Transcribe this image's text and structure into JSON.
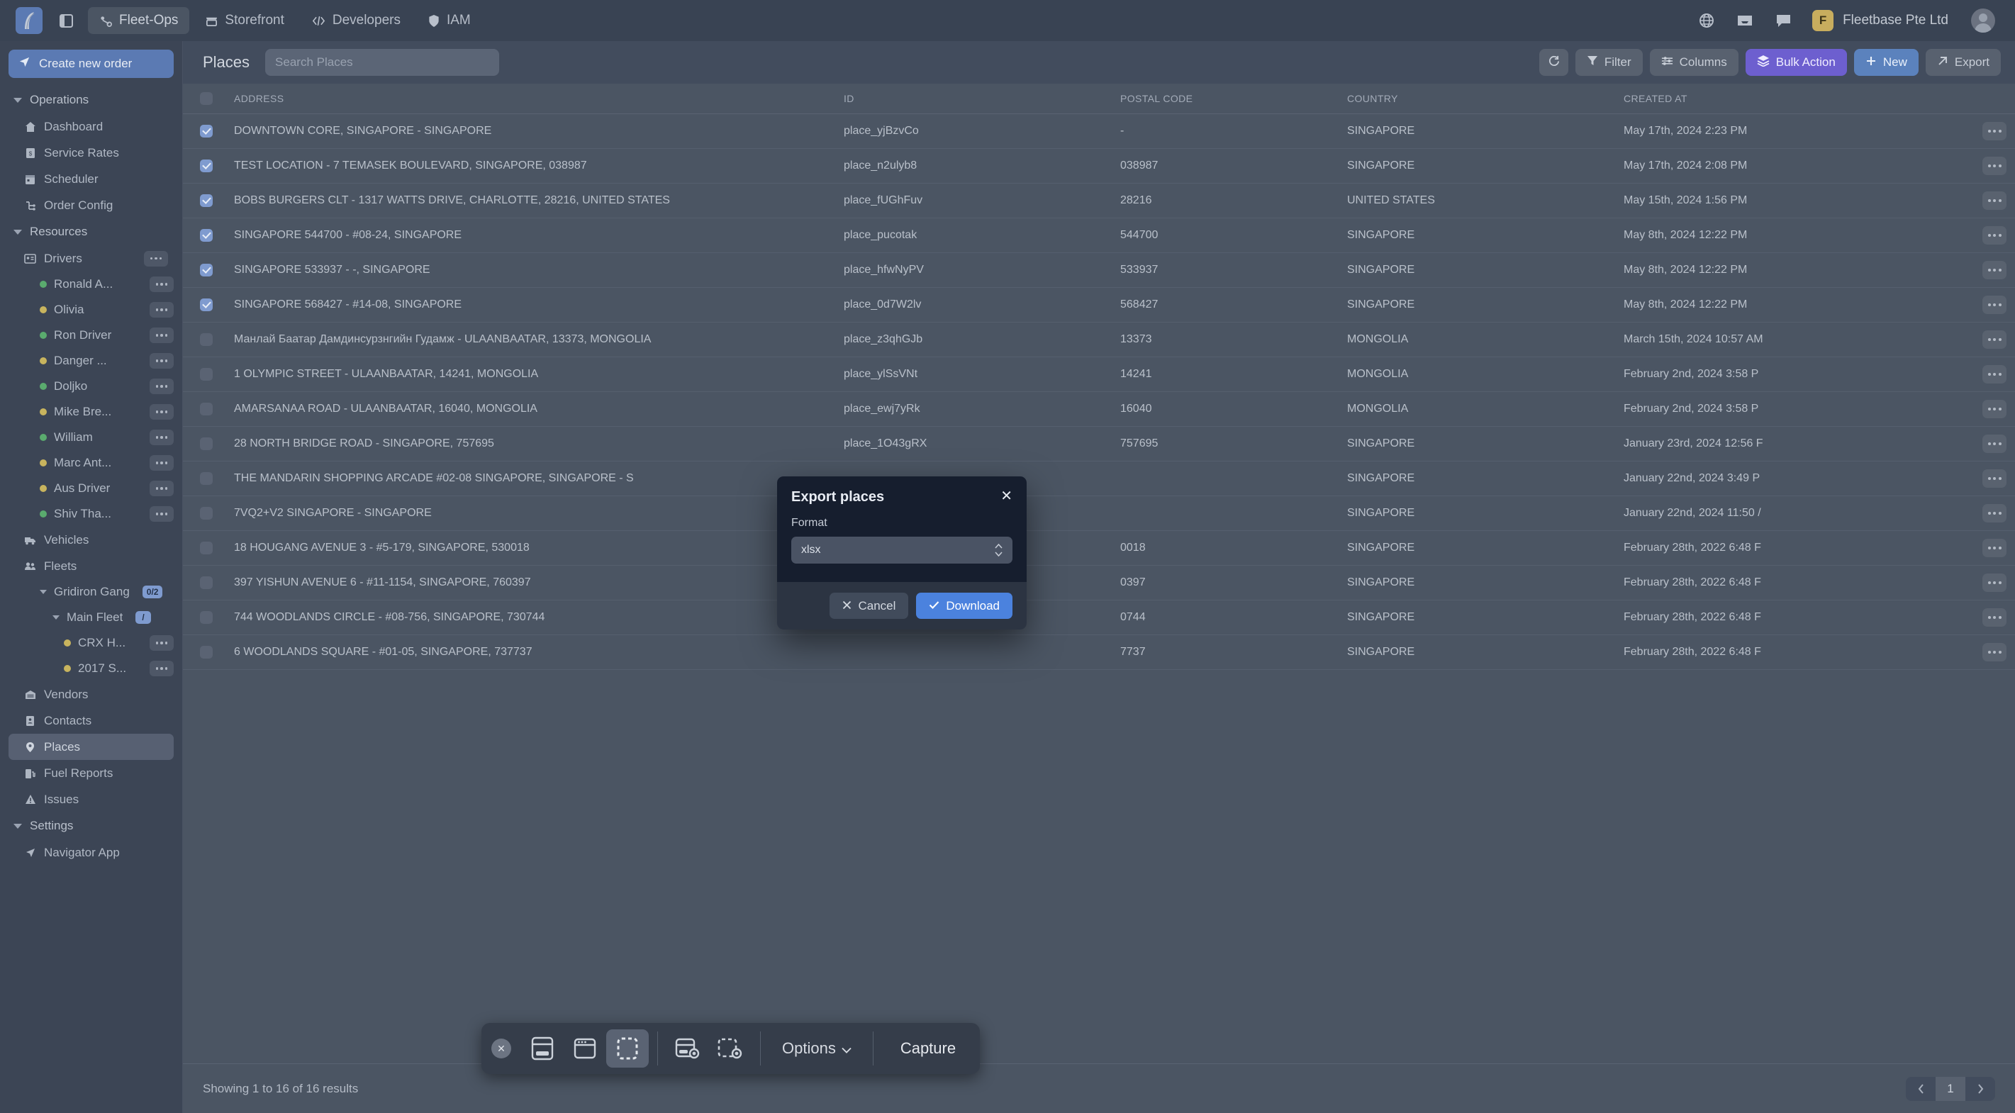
{
  "topbar": {
    "nav": [
      {
        "label": "Fleet-Ops",
        "icon": "fleet-icon",
        "active": true
      },
      {
        "label": "Storefront",
        "icon": "store-icon",
        "active": false
      },
      {
        "label": "Developers",
        "icon": "code-icon",
        "active": false
      },
      {
        "label": "IAM",
        "icon": "shield-icon",
        "active": false
      }
    ],
    "org_initial": "F",
    "org_name": "Fleetbase Pte Ltd"
  },
  "sidebar": {
    "create_label": "Create new order",
    "groups": [
      {
        "label": "Operations",
        "items": [
          {
            "label": "Dashboard",
            "icon": "home-icon"
          },
          {
            "label": "Service Rates",
            "icon": "invoice-icon"
          },
          {
            "label": "Scheduler",
            "icon": "calendar-icon"
          },
          {
            "label": "Order Config",
            "icon": "flow-icon"
          }
        ]
      },
      {
        "label": "Resources",
        "items": [
          {
            "label": "Drivers",
            "icon": "id-card-icon",
            "menu": true
          },
          {
            "label": "Vehicles",
            "icon": "truck-icon"
          },
          {
            "label": "Fleets",
            "icon": "people-icon"
          },
          {
            "label": "Vendors",
            "icon": "warehouse-icon"
          },
          {
            "label": "Contacts",
            "icon": "contact-book-icon"
          },
          {
            "label": "Places",
            "icon": "pin-icon",
            "active": true
          },
          {
            "label": "Fuel Reports",
            "icon": "fuel-icon"
          },
          {
            "label": "Issues",
            "icon": "warning-icon"
          }
        ],
        "drivers": [
          {
            "label": "Ronald A...",
            "status": "green"
          },
          {
            "label": "Olivia",
            "status": "amber"
          },
          {
            "label": "Ron Driver",
            "status": "green"
          },
          {
            "label": "Danger ...",
            "status": "amber"
          },
          {
            "label": "Doljko",
            "status": "green"
          },
          {
            "label": "Mike Bre...",
            "status": "amber"
          },
          {
            "label": "William",
            "status": "green"
          },
          {
            "label": "Marc Ant...",
            "status": "amber"
          },
          {
            "label": "Aus Driver",
            "status": "amber"
          },
          {
            "label": "Shiv Tha...",
            "status": "green"
          }
        ],
        "fleets": [
          {
            "label": "Gridiron Gang",
            "badge": "0/2"
          },
          {
            "label": "Main Fleet",
            "badge": "/"
          }
        ],
        "vehicles": [
          {
            "label": "CRX H...",
            "status": "amber"
          },
          {
            "label": "2017 S...",
            "status": "amber"
          }
        ]
      },
      {
        "label": "Settings",
        "items": [
          {
            "label": "Navigator App",
            "icon": "navigator-icon"
          }
        ]
      }
    ]
  },
  "page": {
    "title": "Places",
    "search_placeholder": "Search Places",
    "search_value": "",
    "actions": [
      {
        "label": "",
        "name": "refresh-button",
        "icon": "refresh-icon",
        "style": "plain"
      },
      {
        "label": "Filter",
        "name": "filter-button",
        "icon": "funnel-icon",
        "style": "plain"
      },
      {
        "label": "Columns",
        "name": "columns-button",
        "icon": "sliders-icon",
        "style": "plain"
      },
      {
        "label": "Bulk Action",
        "name": "bulk-action-button",
        "icon": "layers-icon",
        "style": "purple"
      },
      {
        "label": "New",
        "name": "new-button",
        "icon": "plus-icon",
        "style": "blue"
      },
      {
        "label": "Export",
        "name": "export-button",
        "icon": "arrow-up-right-icon",
        "style": "plain"
      }
    ],
    "accent_purple": "#6d5fcf",
    "accent_blue": "#5b82bd"
  },
  "table": {
    "columns": [
      "ADDRESS",
      "ID",
      "POSTAL CODE",
      "COUNTRY",
      "CREATED AT"
    ],
    "rows": [
      {
        "checked": true,
        "address": "DOWNTOWN CORE, SINGAPORE - SINGAPORE",
        "id": "place_yjBzvCo",
        "postal": "-",
        "country": "SINGAPORE",
        "created": "May 17th, 2024 2:23 PM"
      },
      {
        "checked": true,
        "address": "TEST LOCATION - 7 TEMASEK BOULEVARD, SINGAPORE, 038987",
        "id": "place_n2ulyb8",
        "postal": "038987",
        "country": "SINGAPORE",
        "created": "May 17th, 2024 2:08 PM"
      },
      {
        "checked": true,
        "address": "BOBS BURGERS CLT - 1317 WATTS DRIVE, CHARLOTTE, 28216, UNITED STATES",
        "id": "place_fUGhFuv",
        "postal": "28216",
        "country": "UNITED STATES",
        "created": "May 15th, 2024 1:56 PM"
      },
      {
        "checked": true,
        "address": "SINGAPORE 544700 - #08-24, SINGAPORE",
        "id": "place_pucotak",
        "postal": "544700",
        "country": "SINGAPORE",
        "created": "May 8th, 2024 12:22 PM"
      },
      {
        "checked": true,
        "address": "SINGAPORE 533937 - -, SINGAPORE",
        "id": "place_hfwNyPV",
        "postal": "533937",
        "country": "SINGAPORE",
        "created": "May 8th, 2024 12:22 PM"
      },
      {
        "checked": true,
        "address": "SINGAPORE 568427 - #14-08, SINGAPORE",
        "id": "place_0d7W2lv",
        "postal": "568427",
        "country": "SINGAPORE",
        "created": "May 8th, 2024 12:22 PM"
      },
      {
        "checked": false,
        "address": "Манлай Баатар Дамдинсурзнгийн Гудамж - ULAANBAATAR, 13373, MONGOLIA",
        "id": "place_z3qhGJb",
        "postal": "13373",
        "country": "MONGOLIA",
        "created": "March 15th, 2024 10:57 AM"
      },
      {
        "checked": false,
        "address": "1 OLYMPIC STREET - ULAANBAATAR, 14241, MONGOLIA",
        "id": "place_ylSsVNt",
        "postal": "14241",
        "country": "MONGOLIA",
        "created": "February 2nd, 2024 3:58 P"
      },
      {
        "checked": false,
        "address": "AMARSANAA ROAD - ULAANBAATAR, 16040, MONGOLIA",
        "id": "place_ewj7yRk",
        "postal": "16040",
        "country": "MONGOLIA",
        "created": "February 2nd, 2024 3:58 P"
      },
      {
        "checked": false,
        "address": "28 NORTH BRIDGE ROAD - SINGAPORE, 757695",
        "id": "place_1O43gRX",
        "postal": "757695",
        "country": "SINGAPORE",
        "created": "January 23rd, 2024 12:56 F"
      },
      {
        "checked": false,
        "address": "THE MANDARIN SHOPPING ARCADE #02-08 SINGAPORE, SINGAPORE - S",
        "id": "",
        "postal": "",
        "country": "SINGAPORE",
        "created": "January 22nd, 2024 3:49 P"
      },
      {
        "checked": false,
        "address": "7VQ2+V2 SINGAPORE - SINGAPORE",
        "id": "",
        "postal": "",
        "country": "SINGAPORE",
        "created": "January 22nd, 2024 11:50 /"
      },
      {
        "checked": false,
        "address": "18 HOUGANG AVENUE 3 - #5-179, SINGAPORE, 530018",
        "id": "",
        "postal": "0018",
        "country": "SINGAPORE",
        "created": "February 28th, 2022 6:48 F"
      },
      {
        "checked": false,
        "address": "397 YISHUN AVENUE 6 - #11-1154, SINGAPORE, 760397",
        "id": "",
        "postal": "0397",
        "country": "SINGAPORE",
        "created": "February 28th, 2022 6:48 F"
      },
      {
        "checked": false,
        "address": "744 WOODLANDS CIRCLE - #08-756, SINGAPORE, 730744",
        "id": "",
        "postal": "0744",
        "country": "SINGAPORE",
        "created": "February 28th, 2022 6:48 F"
      },
      {
        "checked": false,
        "address": "6 WOODLANDS SQUARE - #01-05, SINGAPORE, 737737",
        "id": "",
        "postal": "7737",
        "country": "SINGAPORE",
        "created": "February 28th, 2022 6:48 F"
      }
    ]
  },
  "footer": {
    "results_text": "Showing 1 to 16 of 16 results",
    "page_number": "1"
  },
  "modal": {
    "title": "Export places",
    "format_label": "Format",
    "format_value": "xlsx",
    "cancel_label": "Cancel",
    "download_label": "Download"
  },
  "screenshot_toolbar": {
    "options_label": "Options",
    "capture_label": "Capture",
    "modes": [
      "capture-visible-area",
      "capture-window",
      "capture-selected-area",
      "record-window",
      "record-area"
    ],
    "selected_mode": "capture-selected-area"
  }
}
